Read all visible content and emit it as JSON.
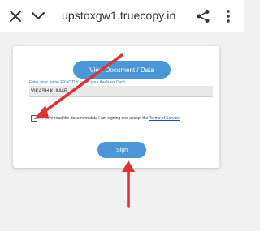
{
  "browser": {
    "url": "upstoxgw1.truecopy.in",
    "icons": [
      "close-icon",
      "chevron-down-icon",
      "share-icon",
      "more-vert-icon"
    ]
  },
  "form": {
    "view_button_label": "View Document / Data",
    "name_field_label": "Enter your name EXACTLY as on your Aadhaar Card",
    "name_value": "VIKASH KUMAR",
    "consent_text": "I have read the document/data I am signing and accept the ",
    "terms_link": "Terms of Service",
    "checkbox_checked": false,
    "sign_button_label": "Sign"
  },
  "colors": {
    "button": "#4a96d6",
    "annotation_arrow": "#e03131",
    "link": "#1f4fa8"
  }
}
